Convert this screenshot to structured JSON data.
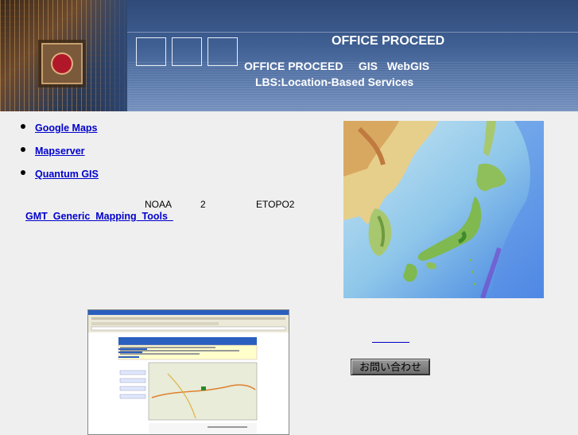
{
  "header": {
    "title": "OFFICE PROCEED",
    "subtitle_line1": "OFFICE PROCEED     GIS   WebGIS",
    "subtitle_line2": "LBS:Location-Based Services"
  },
  "links": [
    {
      "label": "Google Maps"
    },
    {
      "label": "Mapserver"
    },
    {
      "label": "Quantum GIS"
    }
  ],
  "info": {
    "noaa": "NOAA",
    "two": "2",
    "etopo": "ETOPO2",
    "gmt_link": "GMT  Generic  Mapping  Tools  "
  },
  "inquiry_button": "お問い合わせ",
  "colors": {
    "link": "#0000cc",
    "banner": "#3f5f93",
    "background": "#efefef"
  }
}
